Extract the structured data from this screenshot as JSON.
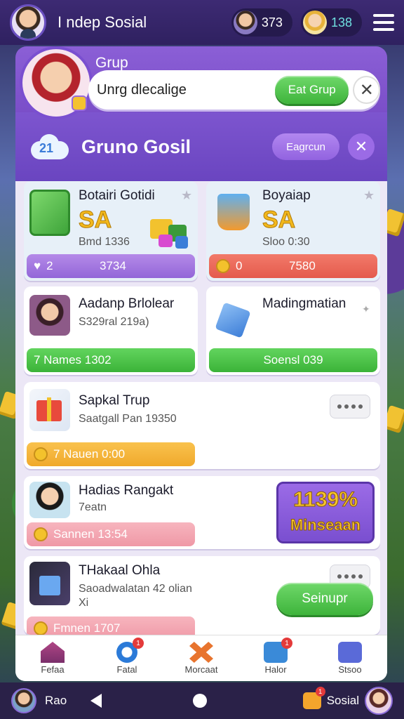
{
  "topbar": {
    "title": "I ndep Sosial",
    "stat1": "373",
    "stat2": "138"
  },
  "group_header": {
    "label": "Grup",
    "input_value": "Unrg dlecalige",
    "button": "Eat Grup"
  },
  "panel": {
    "title": "Gruno Gosil",
    "filter_button": "Eagrcun",
    "cloud_number": "21"
  },
  "cards": [
    {
      "title": "Botairi Gotidi",
      "amount": "SA",
      "sub": "Bmd 1336",
      "bar_left": "2",
      "bar_right": "3734"
    },
    {
      "title": "Boyaiap",
      "amount": "SA",
      "sub": "Sloo 0:30",
      "bar_left": "0",
      "bar_right": "7580"
    },
    {
      "title": "Aadanp Brlolear",
      "sub": "S329ral 219a)",
      "bar": "7 Names 1302"
    },
    {
      "title": "Madingmatian",
      "bar": "Soensl 039"
    },
    {
      "title": "Sapkal Trup",
      "sub": "Saatgall Pan 19350",
      "bar": "7 Nauen 0:00"
    },
    {
      "title": "Hadias Rangakt",
      "sub": "7eatn",
      "bar": "Sannen 13:54",
      "promo_pct": "1139%",
      "promo_label": "Minseaan"
    },
    {
      "title": "THakaal Ohla",
      "sub": "Saoadwalatan 42 olian",
      "sub2": "Xi",
      "bar": "Fmnen 1707",
      "button": "Seinupr"
    }
  ],
  "nav": [
    {
      "label": "Fefaa",
      "icon": "home-icon"
    },
    {
      "label": "Fatal",
      "icon": "circle-icon",
      "badge": "1"
    },
    {
      "label": "Morcaat",
      "icon": "x-icon"
    },
    {
      "label": "Halor",
      "icon": "camera-icon",
      "badge": "1"
    },
    {
      "label": "Stsoo",
      "icon": "settings-icon"
    }
  ],
  "sysbar": {
    "left_label": "Rao",
    "right_label": "Sosial"
  }
}
